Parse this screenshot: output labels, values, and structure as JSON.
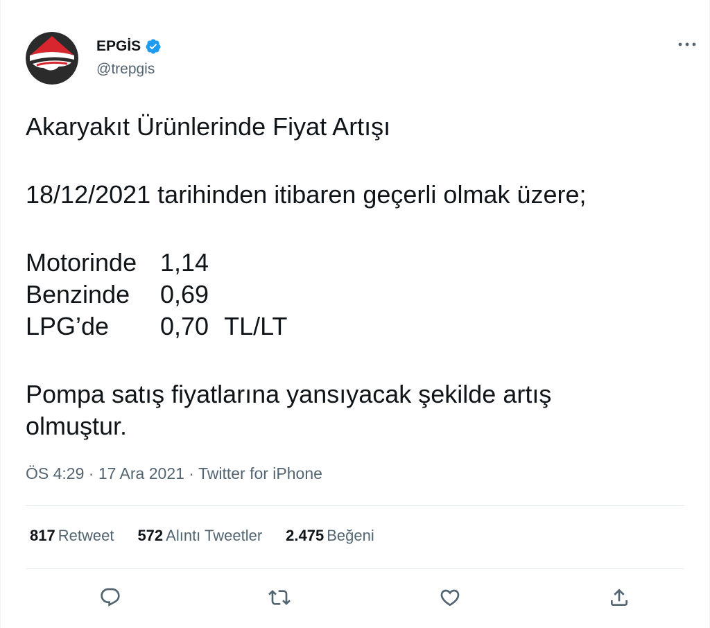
{
  "author": {
    "display_name": "EPGİS",
    "handle": "@trepgis",
    "avatar_icon": "epgis-logo-icon",
    "verified_icon": "verified-badge-icon",
    "brand_red": "#d8262f",
    "brand_dark": "#2b2b2b"
  },
  "tweet": {
    "title": "Akaryakıt Ürünlerinde Fiyat Artışı",
    "date_line": "18/12/2021 tarihinden itibaren geçerli olmak üzere;",
    "prices": [
      {
        "label": "Motorinde",
        "value": "1,14",
        "unit": ""
      },
      {
        "label": "Benzinde",
        "value": "0,69",
        "unit": ""
      },
      {
        "label": "LPG’de",
        "value": "0,70",
        "unit": "TL/LT"
      }
    ],
    "closing_line_1": "Pompa satış fiyatlarına yansıyacak şekilde artış",
    "closing_line_2": "olmuştur."
  },
  "meta": {
    "time": "ÖS 4:29",
    "separator": "·",
    "date": "17 Ara 2021",
    "source": "Twitter for iPhone"
  },
  "stats": [
    {
      "count": "817",
      "label": "Retweet"
    },
    {
      "count": "572",
      "label": "Alıntı Tweetler"
    },
    {
      "count": "2.475",
      "label": "Beğeni"
    }
  ],
  "actions": [
    "reply-icon",
    "retweet-icon",
    "like-icon",
    "share-icon"
  ],
  "colors": {
    "text_primary": "#0f1419",
    "text_secondary": "#536471",
    "verified_blue": "#1d9bf0",
    "divider": "#e6ecf0"
  }
}
